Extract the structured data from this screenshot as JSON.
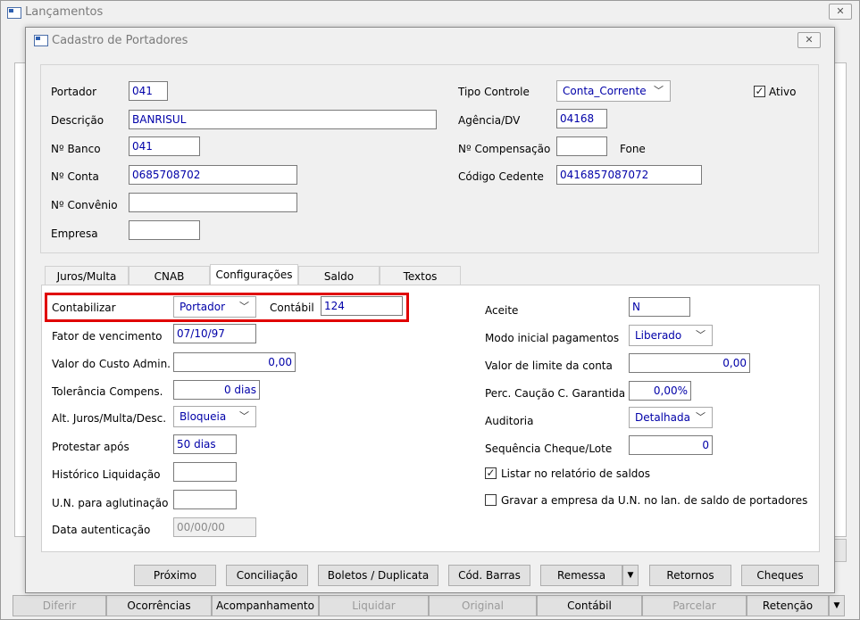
{
  "bg_window": {
    "title": "Lançamentos",
    "bottom_buttons": [
      "Diferir",
      "Ocorrências",
      "Acompanhamento",
      "Liquidar",
      "Original",
      "Contábil",
      "Parcelar",
      "Retenção"
    ]
  },
  "dialog": {
    "title": "Cadastro de Portadores",
    "close": "✕",
    "fields": {
      "portador": {
        "label": "Portador",
        "value": "041"
      },
      "descricao": {
        "label": "Descrição",
        "value": "BANRISUL"
      },
      "nbanco": {
        "label": "Nº Banco",
        "value": "041"
      },
      "nconta": {
        "label": "Nº Conta",
        "value": "0685708702"
      },
      "nconvenio": {
        "label": "Nº Convênio",
        "value": ""
      },
      "empresa": {
        "label": "Empresa",
        "value": ""
      },
      "tipo_controle": {
        "label": "Tipo Controle",
        "value": "Conta_Corrente"
      },
      "ativo": {
        "label": "Ativo",
        "checked": true
      },
      "agencia": {
        "label": "Agência/DV",
        "value": "04168"
      },
      "ncompensacao": {
        "label": "Nº Compensação",
        "value": ""
      },
      "fone": {
        "label": "Fone"
      },
      "codigo_cedente": {
        "label": "Código Cedente",
        "value": "0416857087072"
      }
    },
    "tabs": [
      "Juros/Multa",
      "CNAB",
      "Configurações",
      "Saldo",
      "Textos"
    ],
    "config": {
      "contabilizar": {
        "label": "Contabilizar",
        "value": "Portador"
      },
      "contabil": {
        "label": "Contábil",
        "value": "124"
      },
      "fator": {
        "label": "Fator de vencimento",
        "value": "07/10/97"
      },
      "custo_admin": {
        "label": "Valor do Custo Admin.",
        "value": "0,00"
      },
      "tolerancia": {
        "label": "Tolerância Compens.",
        "value": "0 dias"
      },
      "alt_juros": {
        "label": "Alt. Juros/Multa/Desc.",
        "value": "Bloqueia"
      },
      "protestar": {
        "label": "Protestar após",
        "value": "50 dias"
      },
      "historico": {
        "label": "Histórico Liquidação",
        "value": ""
      },
      "un_aglut": {
        "label": "U.N. para aglutinação",
        "value": ""
      },
      "data_aut": {
        "label": "Data autenticação",
        "value": "00/00/00"
      },
      "aceite": {
        "label": "Aceite",
        "value": "N"
      },
      "modo_pag": {
        "label": "Modo inicial pagamentos",
        "value": "Liberado"
      },
      "limite": {
        "label": "Valor de limite da conta",
        "value": "0,00"
      },
      "caucao": {
        "label": "Perc. Caução C. Garantida",
        "value": "0,00%"
      },
      "auditoria": {
        "label": "Auditoria",
        "value": "Detalhada"
      },
      "seq_cheque": {
        "label": "Sequência Cheque/Lote",
        "value": "0"
      },
      "listar": {
        "label": "Listar no relatório de saldos",
        "checked": true
      },
      "gravar": {
        "label": "Gravar a empresa da U.N. no lan. de saldo de portadores",
        "checked": false
      }
    },
    "buttons": {
      "proximo": "Próximo",
      "conciliacao": "Conciliação",
      "boletos": "Boletos / Duplicata",
      "cod_barras": "Cód. Barras",
      "remessa": "Remessa",
      "retornos": "Retornos",
      "cheques": "Cheques"
    }
  },
  "colors": {
    "highlight": "#e00000",
    "value_text": "#0000a8"
  }
}
